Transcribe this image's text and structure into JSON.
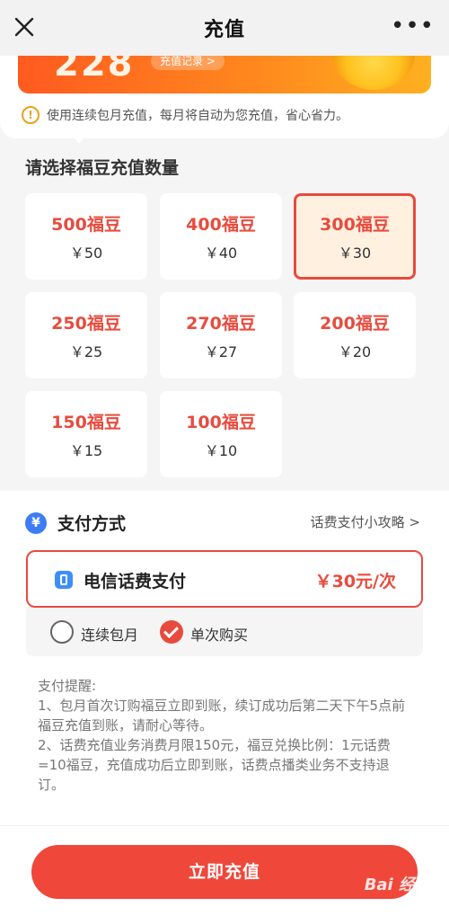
{
  "header": {
    "title": "充值",
    "close_icon": "close-icon",
    "more_icon": "more-dots-icon"
  },
  "banner": {
    "number": "228",
    "record_link": "充值记录 >"
  },
  "tip": {
    "text": "使用连续包月充值，每月将自动为您充值，省心省力。"
  },
  "packages": {
    "title": "请选择福豆充值数量",
    "items": [
      {
        "name": "500福豆",
        "price": "￥50"
      },
      {
        "name": "400福豆",
        "price": "￥40"
      },
      {
        "name": "300福豆",
        "price": "￥30",
        "selected": true
      },
      {
        "name": "250福豆",
        "price": "￥25"
      },
      {
        "name": "270福豆",
        "price": "￥27"
      },
      {
        "name": "200福豆",
        "price": "￥20"
      },
      {
        "name": "150福豆",
        "price": "￥15"
      },
      {
        "name": "100福豆",
        "price": "￥10"
      }
    ]
  },
  "payment": {
    "title": "支付方式",
    "guide_link": "话费支付小攻略 >",
    "option": {
      "label": "电信话费支付",
      "price": "￥30元/次"
    },
    "modes": [
      {
        "label": "连续包月",
        "checked": false
      },
      {
        "label": "单次购买",
        "checked": true
      }
    ]
  },
  "notes": {
    "title": "支付提醒:",
    "lines": [
      "1、包月首次订购福豆立即到账，续订成功后第二天下午5点前福豆充值到账，请耐心等待。",
      "2、话费充值业务消费月限150元，福豆兑换比例：1元话费=10福豆，充值成功后立即到账，话费点播类业务不支持退订。"
    ]
  },
  "submit_label": "立即充值",
  "colors": {
    "accent": "#e84b3e",
    "button": "#f0473b",
    "selected_bg": "#fff0df",
    "pay_icon": "#3e7cf5"
  }
}
